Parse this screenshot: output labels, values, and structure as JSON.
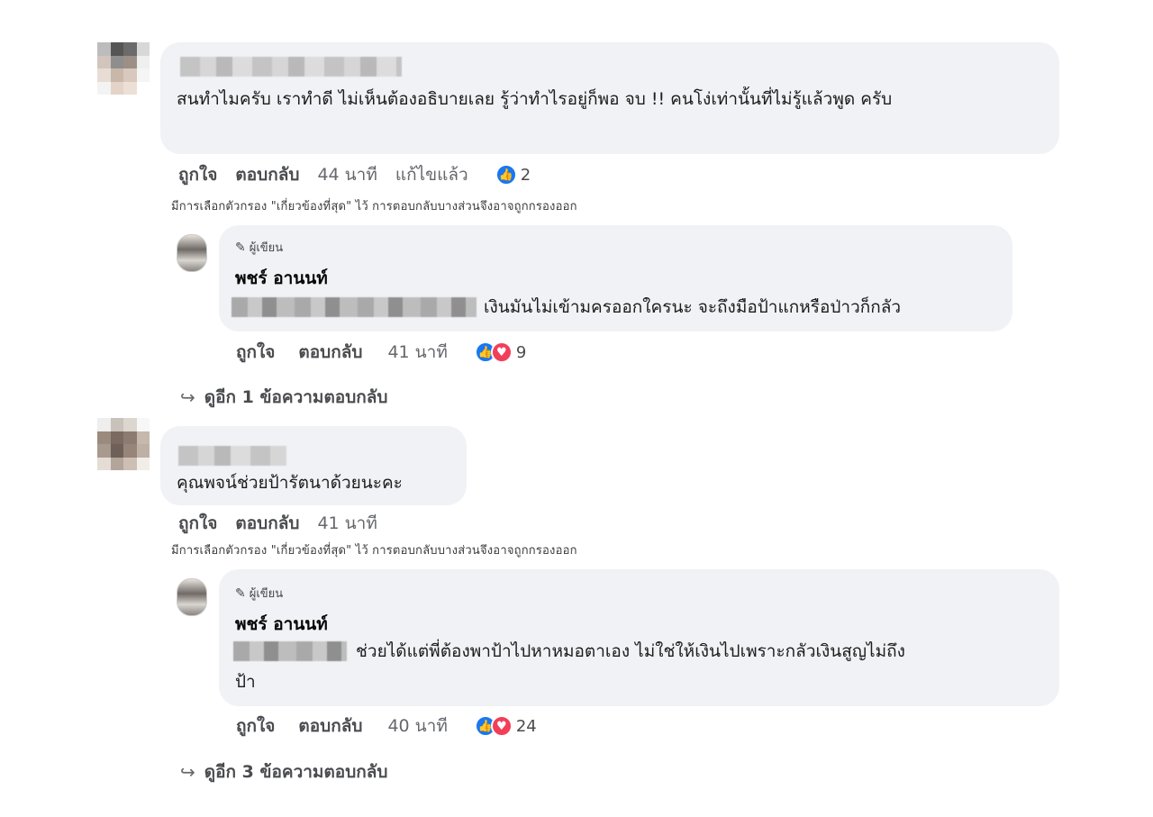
{
  "thread": {
    "comment1": {
      "text": "สนทำไมครับ เราทำดี ไม่เห็นต้องอธิบายเลย รู้ว่าทำไรอยู่ก็พอ จบ !! คนโง่เท่านั้นที่ไม่รู้แล้วพูด ครับ",
      "like_label": "ถูกใจ",
      "reply_label": "ตอบกลับ",
      "time": "44 นาที",
      "edited": "แก้ไขแล้ว",
      "reaction_count": "2"
    },
    "filter_note_1": "มีการเลือกตัวกรอง \"เกี่ยวข้องที่สุด\" ไว้ การตอบกลับบางส่วนจึงอาจถูกกรองออก",
    "reply1": {
      "badge": "ผู้เขียน",
      "author": "พชร์ อานนท์",
      "text": "เงินมันไม่เข้ามครออกใครนะ จะถึงมือป้าแกหรือป่าวก็กลัว",
      "like_label": "ถูกใจ",
      "reply_label": "ตอบกลับ",
      "time": "41 นาที",
      "reaction_count": "9"
    },
    "more_replies_1": "ดูอีก 1 ข้อความตอบกลับ",
    "comment2": {
      "text": "คุณพจน์ช่วยป้ารัตนาด้วยนะคะ",
      "like_label": "ถูกใจ",
      "reply_label": "ตอบกลับ",
      "time": "41 นาที"
    },
    "filter_note_2": "มีการเลือกตัวกรอง \"เกี่ยวข้องที่สุด\" ไว้ การตอบกลับบางส่วนจึงอาจถูกกรองออก",
    "reply2": {
      "badge": "ผู้เขียน",
      "author": "พชร์ อานนท์",
      "text_line1": "ช่วยได้แต่พี่ต้องพาป้าไปหาหมอตาเอง ไม่ใช่ให้เงินไปเพราะกลัวเงินสูญไม่ถึง",
      "text_line2": "ป้า",
      "like_label": "ถูกใจ",
      "reply_label": "ตอบกลับ",
      "time": "40 นาที",
      "reaction_count": "24"
    },
    "more_replies_2": "ดูอีก 3 ข้อความตอบกลับ"
  },
  "icons": {
    "like": "like-icon",
    "love": "love-icon",
    "pencil": "pencil-icon",
    "reply_arrow": "reply-arrow-icon"
  },
  "colors": {
    "bubble": "#f0f2f5",
    "like_blue": "#1877f2",
    "love_red": "#f33e58",
    "secondary_text": "#65676b"
  }
}
